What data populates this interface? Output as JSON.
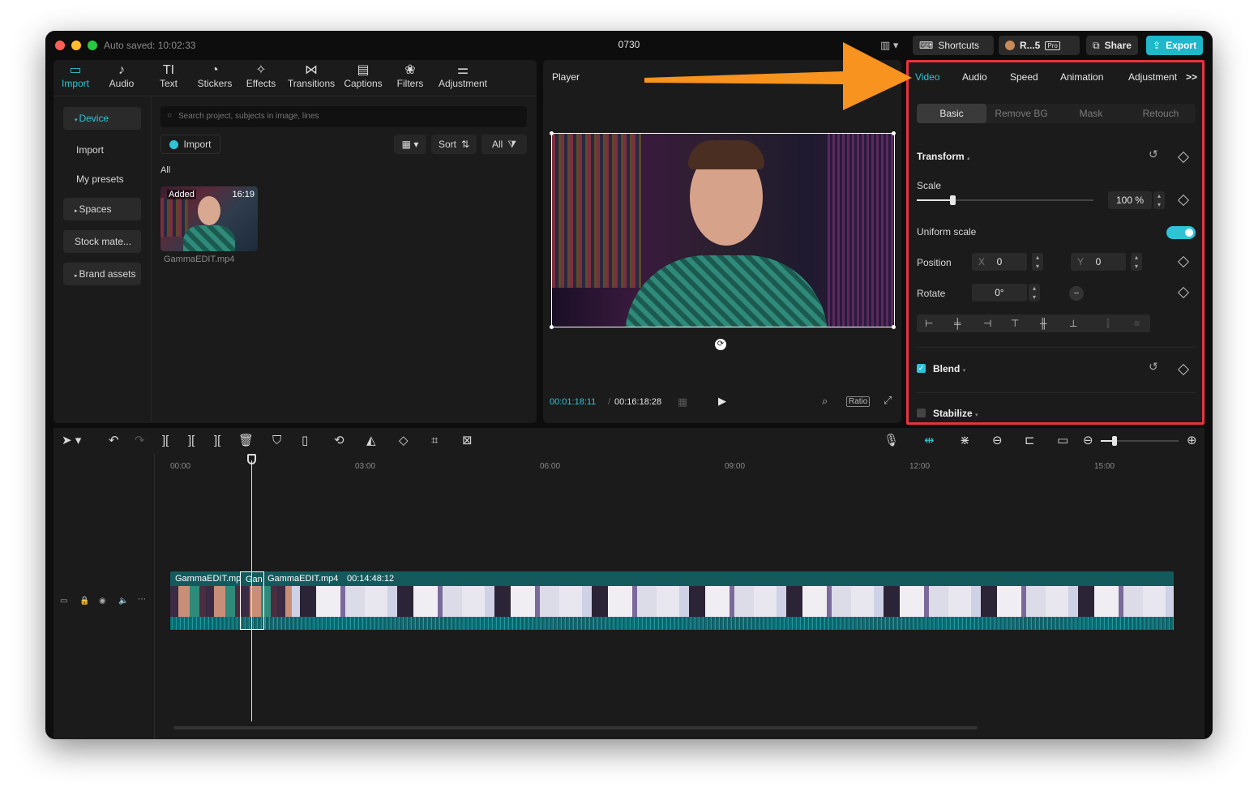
{
  "titlebar": {
    "saved_text": "Auto saved: 10:02:33",
    "project_title": "0730",
    "shortcuts": "Shortcuts",
    "account": "R...5",
    "pro": "Pro",
    "share": "Share",
    "export": "Export"
  },
  "media_tools": [
    {
      "label": "Import",
      "icon": "▭"
    },
    {
      "label": "Audio",
      "icon": "♪"
    },
    {
      "label": "Text",
      "icon": "TI"
    },
    {
      "label": "Stickers",
      "icon": "◔"
    },
    {
      "label": "Effects",
      "icon": "✧"
    },
    {
      "label": "Transitions",
      "icon": "⋈"
    },
    {
      "label": "Captions",
      "icon": "▤"
    },
    {
      "label": "Filters",
      "icon": "❀"
    },
    {
      "label": "Adjustment",
      "icon": "⚌"
    }
  ],
  "sidebar": {
    "device": "Device",
    "import": "Import",
    "my_presets": "My presets",
    "spaces": "Spaces",
    "stock": "Stock mate...",
    "brand": "Brand assets"
  },
  "library": {
    "search_placeholder": "Search project, subjects in image, lines",
    "import_button": "Import",
    "sort": "Sort",
    "all_filter": "All",
    "section": "All",
    "clip_badge": "Added",
    "clip_duration": "16:19",
    "clip_name": "GammaEDIT.mp4"
  },
  "player": {
    "title": "Player",
    "current_time": "00:01:18:11",
    "total_time": "00:16:18:28",
    "ratio": "Ratio"
  },
  "properties": {
    "tabs": [
      "Video",
      "Audio",
      "Speed",
      "Animation",
      "Adjustment"
    ],
    "subtabs": [
      "Basic",
      "Remove BG",
      "Mask",
      "Retouch"
    ],
    "transform": "Transform",
    "scale_label": "Scale",
    "scale_value": "100 %",
    "scale_fraction": 0.2,
    "uniform_scale": "Uniform scale",
    "position_label": "Position",
    "x_label": "X",
    "x_value": "0",
    "y_label": "Y",
    "y_value": "0",
    "rotate_label": "Rotate",
    "rotate_value": "0°",
    "blend": "Blend",
    "stabilize": "Stabilize"
  },
  "timeline": {
    "ruler": [
      "00:00",
      "03:00",
      "06:00",
      "09:00",
      "12:00",
      "15:00"
    ],
    "clip1_label": "GammaEDIT.mp",
    "clip2_label": "Gan",
    "clip3_label": "GammaEDIT.mp4",
    "clip3_duration": "00:14:48:12"
  },
  "colors": {
    "accent": "#2ec4d6",
    "highlight": "#e8323f",
    "arrow": "#f7931e"
  }
}
